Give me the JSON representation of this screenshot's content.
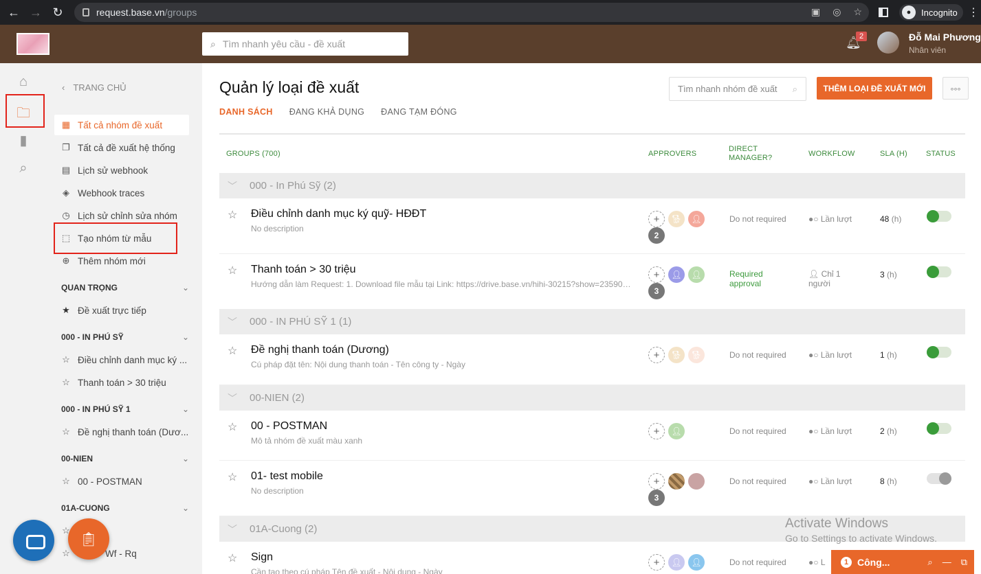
{
  "browser": {
    "host": "request.base.vn",
    "path": "/groups",
    "incognito": "Incognito"
  },
  "header": {
    "search_placeholder": "Tìm nhanh yêu cầu - đề xuất",
    "notif_count": "2",
    "user_name": "Đỗ Mai Phương",
    "user_role": "Nhân viên"
  },
  "sidebar": {
    "back": "TRANG CHỦ",
    "items": [
      {
        "label": "Tất cả nhóm đề xuất",
        "icon": "grid-icon"
      },
      {
        "label": "Tất cả đề xuất hệ thống",
        "icon": "copy-icon"
      },
      {
        "label": "Lịch sử webhook",
        "icon": "doc-icon"
      },
      {
        "label": "Webhook traces",
        "icon": "layers-icon"
      },
      {
        "label": "Lịch sử chỉnh sửa nhóm",
        "icon": "clock-icon"
      },
      {
        "label": "Tạo nhóm từ mẫu",
        "icon": "template-icon"
      },
      {
        "label": "Thêm nhóm mới",
        "icon": "plus-circle-icon"
      }
    ],
    "sections": [
      {
        "title": "QUAN TRỌNG",
        "items": [
          "Đề xuất trực tiếp"
        ]
      },
      {
        "title": "000 - IN PHÚ SỸ",
        "items": [
          "Điều chỉnh danh mục ký ...",
          "Thanh toán > 30 triệu"
        ]
      },
      {
        "title": "000 - IN PHÚ SỸ 1",
        "items": [
          "Đề nghị thanh toán (Dươ..."
        ]
      },
      {
        "title": "00-NIEN",
        "items": [
          "00 - POSTMAN"
        ]
      },
      {
        "title": "01A-CUONG",
        "items": [
          "",
          "Wf - Rq"
        ]
      }
    ]
  },
  "main": {
    "title": "Quản lý loại đề xuất",
    "tabs": [
      "DANH SÁCH",
      "ĐANG KHẢ DỤNG",
      "ĐANG TẠM ĐÓNG"
    ],
    "search_placeholder": "Tìm nhanh nhóm đề xuất",
    "add_label": "THÊM LOẠI ĐỀ XUẤT MỚI",
    "more_label": "◦◦◦",
    "columns": {
      "groups": "GROUPS (700)",
      "approvers": "APPROVERS",
      "direct_1": "DIRECT",
      "direct_2": "MANAGER?",
      "workflow": "WORKFLOW",
      "sla": "SLA (H)",
      "status": "STATUS"
    },
    "groups": [
      "000 - In Phú Sỹ (2)",
      "000 - IN PHÚ SỸ 1 (1)",
      "00-NIEN (2)",
      "01A-Cuong (2)"
    ],
    "rows": [
      {
        "name": "Điều chỉnh danh mục ký quỹ- HĐĐT",
        "desc": "No description",
        "count": "2",
        "dm": "Do not required",
        "wf": "Lần lượt",
        "sla": "48",
        "unit": "(h)",
        "active": true
      },
      {
        "name": "Thanh toán > 30 triệu",
        "desc": "Hướng dẫn làm Request: 1. Download file mẫu tại Link: https://drive.base.vn/hihi-30215?show=235908 ...",
        "count": "3",
        "dm1": "Required",
        "dm2": "approval",
        "wf1": "Chỉ 1",
        "wf2": "người",
        "sla": "3",
        "unit": "(h)",
        "active": true
      },
      {
        "name": "Đề nghị thanh toán (Dương)",
        "desc": "Cú pháp đặt tên: Nội dung thanh toán - Tên công ty - Ngày",
        "dm": "Do not required",
        "wf": "Lần lượt",
        "sla": "1",
        "unit": "(h)",
        "active": true
      },
      {
        "name": "00 - POSTMAN",
        "desc": "Mô tả nhóm đề xuất màu xanh",
        "dm": "Do not required",
        "wf": "Lần lượt",
        "sla": "2",
        "unit": "(h)",
        "active": true
      },
      {
        "name": "01- test mobile",
        "desc": "No description",
        "count": "3",
        "dm": "Do not required",
        "wf": "Lần lượt",
        "sla": "8",
        "unit": "(h)",
        "active": false
      },
      {
        "name": "Sign",
        "desc": "Cần tạo theo cú pháp Tên đề xuất - Nội dung - Ngày",
        "dm": "Do not required",
        "wf": "L"
      }
    ]
  },
  "overlay": {
    "watermark_1": "Activate Windows",
    "watermark_2": "Go to Settings to activate Windows.",
    "chat_count": "1",
    "chat_label": "Công..."
  }
}
